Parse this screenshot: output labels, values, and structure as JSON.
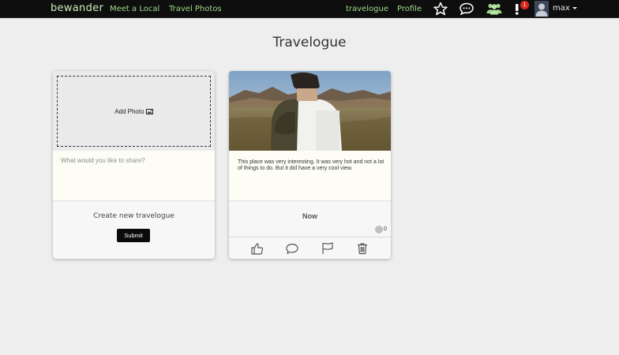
{
  "nav": {
    "brand": "bewander",
    "links": [
      "Meet a Local",
      "Travel Photos"
    ],
    "right_links": [
      "travelogue",
      "Profile"
    ],
    "notification_count": "1",
    "username": "max",
    "icons": [
      "star-icon",
      "chat-icon",
      "people-icon",
      "alert-icon",
      "avatar-icon"
    ],
    "accent_color": "#9fd88a"
  },
  "page": {
    "title": "Travelogue"
  },
  "new_card": {
    "add_photo_label": "Add Photo",
    "placeholder": "What would you like to share?",
    "create_label": "Create new travelogue",
    "submit_label": "Submit"
  },
  "post": {
    "text": "This place was very interesting. It was very hot and not a lot of things to do. But it did have a very cool view.",
    "time": "Now",
    "likes": "0",
    "actions": [
      "thumbs-up-icon",
      "comment-icon",
      "flag-icon",
      "trash-icon"
    ]
  }
}
